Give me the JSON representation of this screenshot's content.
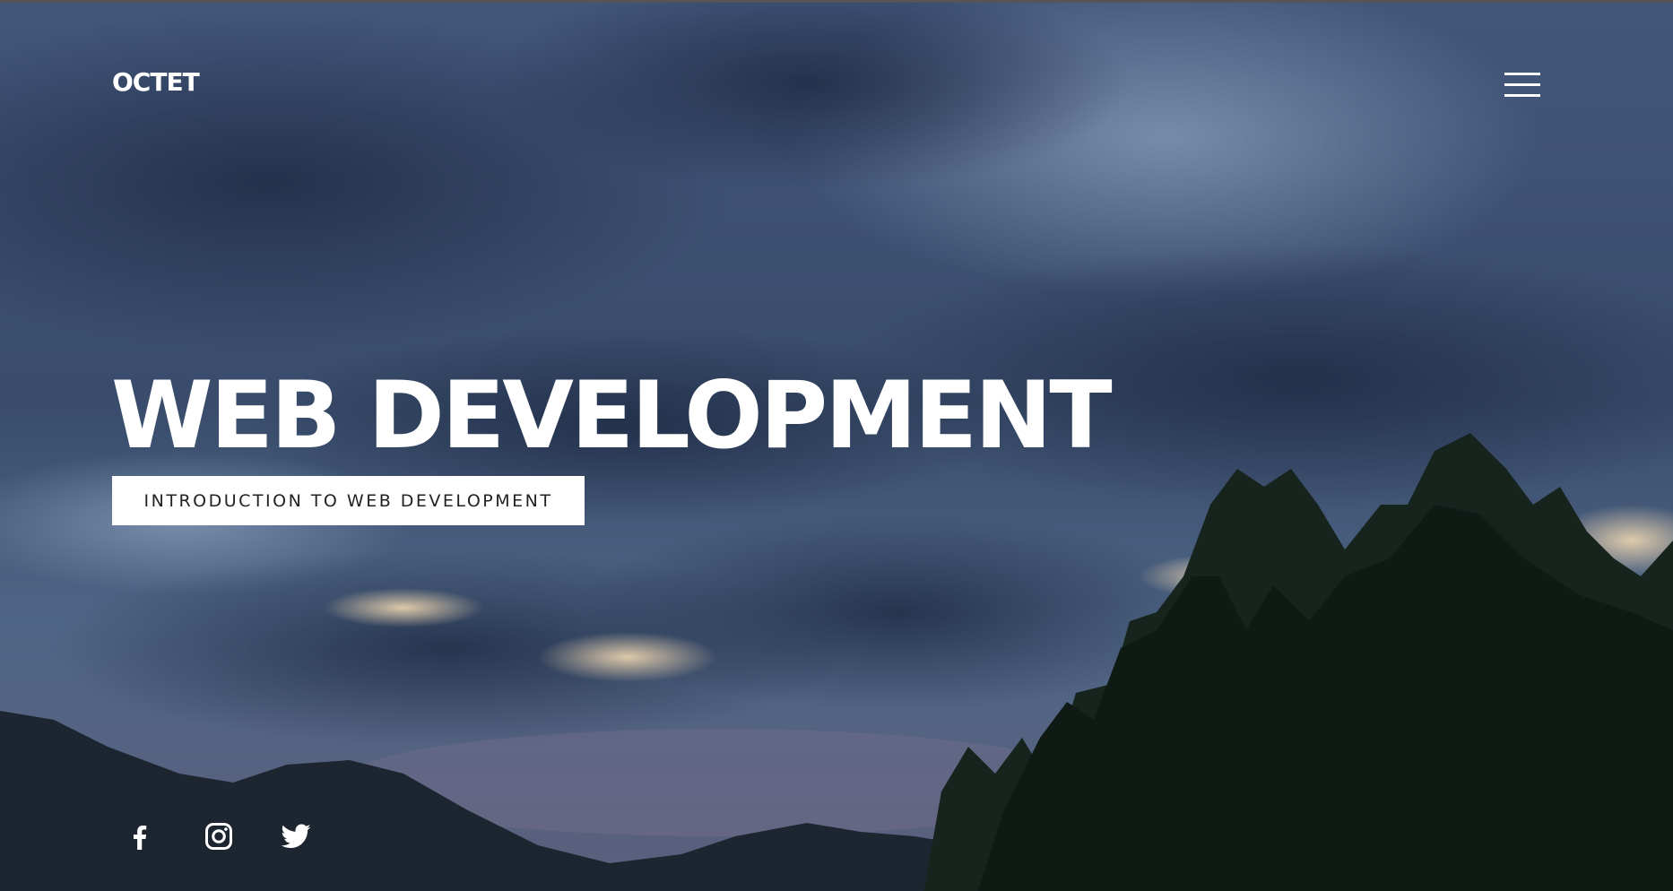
{
  "header": {
    "logo_text": "OCTET",
    "menu_icon": "hamburger-menu-icon"
  },
  "hero": {
    "headline": "WEB DEVELOPMENT",
    "cta_label": "INTRODUCTION TO WEB DEVELOPMENT"
  },
  "social": [
    {
      "icon": "facebook-icon"
    },
    {
      "icon": "instagram-icon"
    },
    {
      "icon": "twitter-icon"
    }
  ],
  "colors": {
    "sky_top": "#3d4f6e",
    "sky_mid": "#4c6280",
    "clouds_dark": "#263551",
    "horizon_glow": "#e8cfa8",
    "tree": "#1a2a22",
    "text": "#ffffff"
  }
}
